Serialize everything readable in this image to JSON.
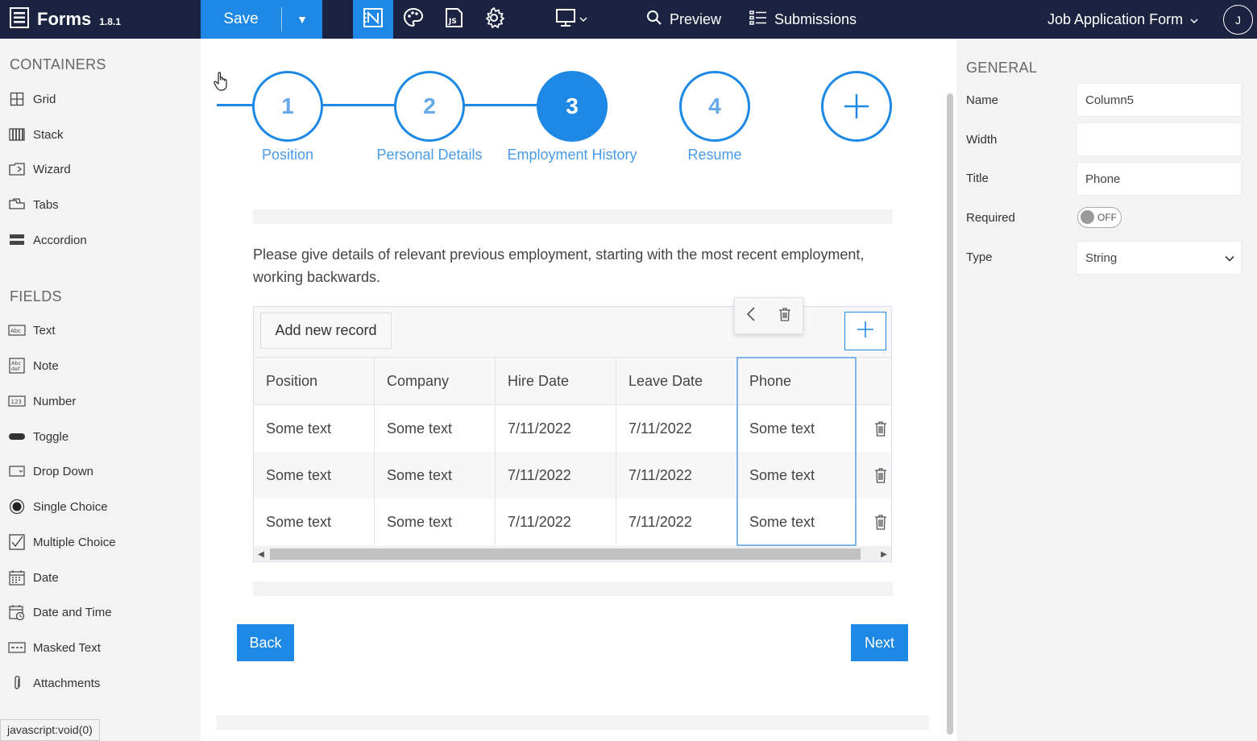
{
  "topbar": {
    "app_title": "Forms",
    "version": "1.8.1",
    "save_label": "Save",
    "preview_label": "Preview",
    "submissions_label": "Submissions",
    "form_name": "Job Application Form",
    "avatar_initial": "J"
  },
  "sidebar": {
    "containers_title": "CONTAINERS",
    "containers": [
      {
        "label": "Grid",
        "icon": "grid-icon"
      },
      {
        "label": "Stack",
        "icon": "stack-icon"
      },
      {
        "label": "Wizard",
        "icon": "wizard-icon"
      },
      {
        "label": "Tabs",
        "icon": "tabs-icon"
      },
      {
        "label": "Accordion",
        "icon": "accordion-icon"
      }
    ],
    "fields_title": "FIELDS",
    "fields": [
      {
        "label": "Text",
        "icon": "text-field-icon"
      },
      {
        "label": "Note",
        "icon": "note-icon"
      },
      {
        "label": "Number",
        "icon": "number-icon"
      },
      {
        "label": "Toggle",
        "icon": "toggle-icon"
      },
      {
        "label": "Drop Down",
        "icon": "dropdown-icon"
      },
      {
        "label": "Single Choice",
        "icon": "radio-icon"
      },
      {
        "label": "Multiple Choice",
        "icon": "checkbox-icon"
      },
      {
        "label": "Date",
        "icon": "calendar-icon"
      },
      {
        "label": "Date and Time",
        "icon": "calendar-clock-icon"
      },
      {
        "label": "Masked Text",
        "icon": "masked-text-icon"
      },
      {
        "label": "Attachments",
        "icon": "paperclip-icon"
      }
    ]
  },
  "status_bar": "javascript:void(0)",
  "wizard": {
    "steps": [
      {
        "number": "1",
        "label": "Position"
      },
      {
        "number": "2",
        "label": "Personal Details"
      },
      {
        "number": "3",
        "label": "Employment History"
      },
      {
        "number": "4",
        "label": "Resume"
      }
    ],
    "active_step": 3
  },
  "description": "Please give details of relevant previous employment, starting with the most recent employment, working backwards.",
  "table": {
    "add_record_label": "Add new record",
    "columns": [
      "Position",
      "Company",
      "Hire Date",
      "Leave Date",
      "Phone"
    ],
    "rows": [
      [
        "Some text",
        "Some text",
        "7/11/2022",
        "7/11/2022",
        "Some text"
      ],
      [
        "Some text",
        "Some text",
        "7/11/2022",
        "7/11/2022",
        "Some text"
      ],
      [
        "Some text",
        "Some text",
        "7/11/2022",
        "7/11/2022",
        "Some text"
      ]
    ],
    "selected_column": "Phone"
  },
  "nav": {
    "back_label": "Back",
    "next_label": "Next"
  },
  "properties": {
    "section_title": "GENERAL",
    "name_label": "Name",
    "name_value": "Column5",
    "width_label": "Width",
    "width_value": "",
    "title_label": "Title",
    "title_value": "Phone",
    "required_label": "Required",
    "required_state": "OFF",
    "type_label": "Type",
    "type_value": "String"
  },
  "colors": {
    "topbar_bg": "#1c2340",
    "accent": "#1e88e5",
    "panel_bg": "#f3f3f3"
  }
}
